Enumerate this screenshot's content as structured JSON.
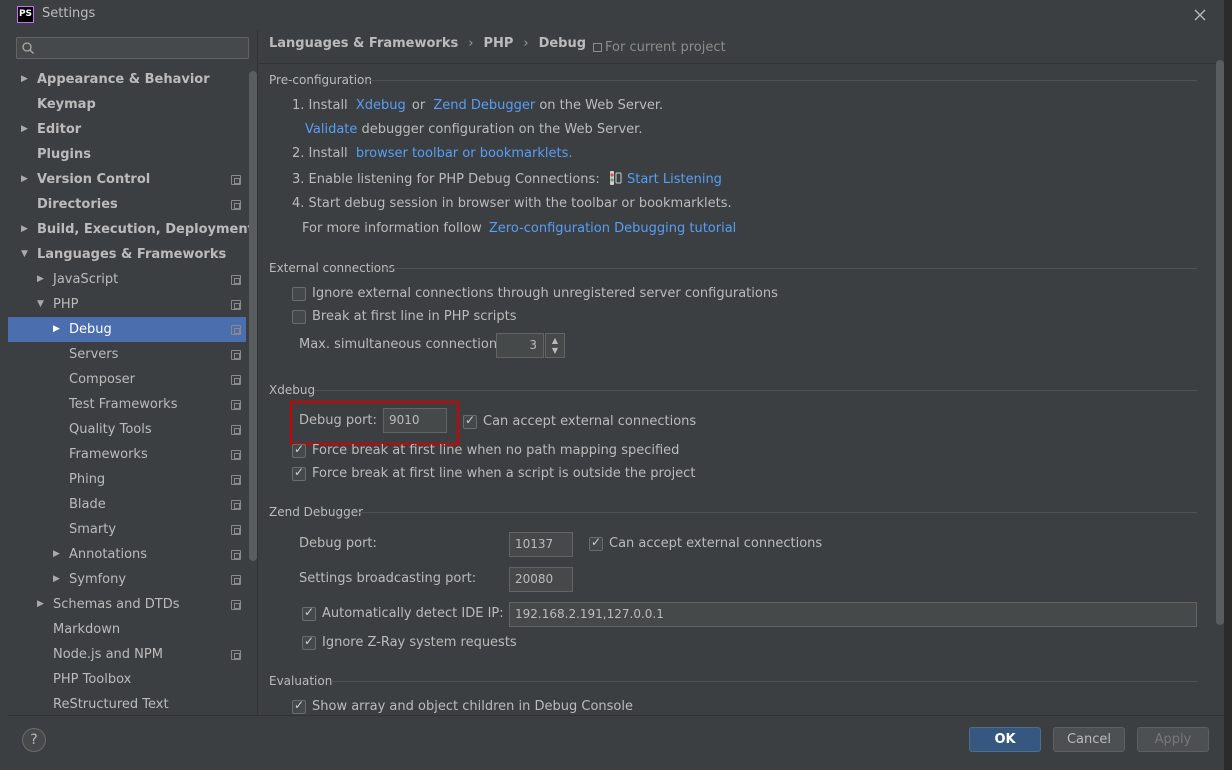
{
  "window": {
    "title": "Settings",
    "app_icon": "PS"
  },
  "search": {
    "placeholder": ""
  },
  "sidebar": {
    "items": [
      {
        "label": "Appearance & Behavior",
        "bold": true,
        "arrow": "▶",
        "indent": 0,
        "proj": false
      },
      {
        "label": "Keymap",
        "bold": true,
        "arrow": "",
        "indent": 0,
        "proj": false
      },
      {
        "label": "Editor",
        "bold": true,
        "arrow": "▶",
        "indent": 0,
        "proj": false
      },
      {
        "label": "Plugins",
        "bold": true,
        "arrow": "",
        "indent": 0,
        "proj": false
      },
      {
        "label": "Version Control",
        "bold": true,
        "arrow": "▶",
        "indent": 0,
        "proj": true
      },
      {
        "label": "Directories",
        "bold": true,
        "arrow": "",
        "indent": 0,
        "proj": true
      },
      {
        "label": "Build, Execution, Deployment",
        "bold": true,
        "arrow": "▶",
        "indent": 0,
        "proj": false
      },
      {
        "label": "Languages & Frameworks",
        "bold": true,
        "arrow": "▼",
        "indent": 0,
        "proj": false
      },
      {
        "label": "JavaScript",
        "bold": false,
        "arrow": "▶",
        "indent": 1,
        "proj": true
      },
      {
        "label": "PHP",
        "bold": false,
        "arrow": "▼",
        "indent": 1,
        "proj": true
      },
      {
        "label": "Debug",
        "bold": false,
        "arrow": "▶",
        "indent": 2,
        "proj": true,
        "selected": true
      },
      {
        "label": "Servers",
        "bold": false,
        "arrow": "",
        "indent": 2,
        "proj": true
      },
      {
        "label": "Composer",
        "bold": false,
        "arrow": "",
        "indent": 2,
        "proj": true
      },
      {
        "label": "Test Frameworks",
        "bold": false,
        "arrow": "",
        "indent": 2,
        "proj": true
      },
      {
        "label": "Quality Tools",
        "bold": false,
        "arrow": "",
        "indent": 2,
        "proj": true
      },
      {
        "label": "Frameworks",
        "bold": false,
        "arrow": "",
        "indent": 2,
        "proj": true
      },
      {
        "label": "Phing",
        "bold": false,
        "arrow": "",
        "indent": 2,
        "proj": true
      },
      {
        "label": "Blade",
        "bold": false,
        "arrow": "",
        "indent": 2,
        "proj": true
      },
      {
        "label": "Smarty",
        "bold": false,
        "arrow": "",
        "indent": 2,
        "proj": true
      },
      {
        "label": "Annotations",
        "bold": false,
        "arrow": "▶",
        "indent": 2,
        "proj": true
      },
      {
        "label": "Symfony",
        "bold": false,
        "arrow": "▶",
        "indent": 2,
        "proj": true
      },
      {
        "label": "Schemas and DTDs",
        "bold": false,
        "arrow": "▶",
        "indent": 1,
        "proj": true
      },
      {
        "label": "Markdown",
        "bold": false,
        "arrow": "",
        "indent": 1,
        "proj": false
      },
      {
        "label": "Node.js and NPM",
        "bold": false,
        "arrow": "",
        "indent": 1,
        "proj": true
      },
      {
        "label": "PHP Toolbox",
        "bold": false,
        "arrow": "",
        "indent": 1,
        "proj": false
      },
      {
        "label": "ReStructured Text",
        "bold": false,
        "arrow": "",
        "indent": 1,
        "proj": false
      }
    ]
  },
  "breadcrumb": {
    "part1": "Languages & Frameworks",
    "part2": "PHP",
    "part3": "Debug",
    "sep": "›"
  },
  "scope": "For current project",
  "preconfig": {
    "title": "Pre-configuration",
    "s1_a": "1. Install",
    "s1_link1": "Xdebug",
    "s1_or": "or",
    "s1_link2": "Zend Debugger",
    "s1_b": "on the Web Server.",
    "s1_validate": "Validate",
    "s1_validate_rest": "debugger configuration on the Web Server.",
    "s2_a": "2. Install",
    "s2_link": "browser toolbar or bookmarklets.",
    "s3_a": "3. Enable listening for PHP Debug Connections:",
    "s3_link": "Start Listening",
    "s4": "4. Start debug session in browser with the toolbar or bookmarklets.",
    "s5_a": "For more information follow",
    "s5_link": "Zero-configuration Debugging tutorial"
  },
  "external": {
    "title": "External connections",
    "ignore": "Ignore external connections through unregistered server configurations",
    "ignore_checked": false,
    "break_first": "Break at first line in PHP scripts",
    "break_first_checked": false,
    "max_label": "Max. simultaneous connections:",
    "max_value": "3"
  },
  "xdebug": {
    "title": "Xdebug",
    "port_label": "Debug port:",
    "port_value": "9010",
    "accept": "Can accept external connections",
    "force1": "Force break at first line when no path mapping specified",
    "force2": "Force break at first line when a script is outside the project"
  },
  "zend": {
    "title": "Zend Debugger",
    "port_label": "Debug port:",
    "port_value": "10137",
    "accept": "Can accept external connections",
    "broadcast_label": "Settings broadcasting port:",
    "broadcast_value": "20080",
    "auto_detect": "Automatically detect IDE IP:",
    "ip_value": "192.168.2.191,127.0.0.1",
    "ignore_zray": "Ignore Z-Ray system requests"
  },
  "evaluation": {
    "title": "Evaluation",
    "show_array": "Show array and object children in Debug Console"
  },
  "buttons": {
    "help": "?",
    "ok": "OK",
    "cancel": "Cancel",
    "apply": "Apply"
  },
  "colors": {
    "selection": "#4b6eaf",
    "link": "#589df6",
    "highlight_box": "#d20000",
    "ok_button": "#365880"
  }
}
